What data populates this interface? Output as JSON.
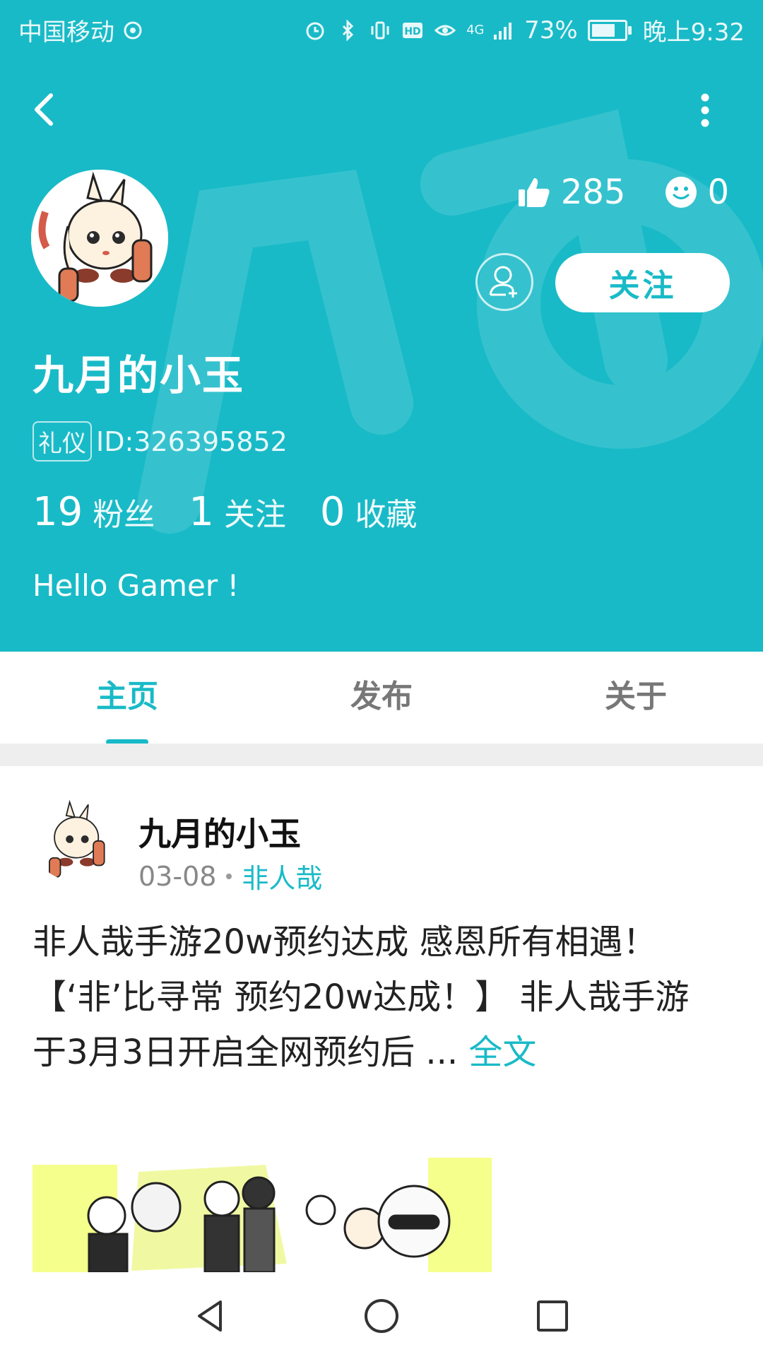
{
  "status_bar": {
    "carrier": "中国移动",
    "network": "4G",
    "battery": "73%",
    "battery_level": 0.73,
    "time": "晚上9:32"
  },
  "profile": {
    "username": "九月的小玉",
    "tag": "礼仪",
    "id_text": "ID:326395852",
    "likes": "285",
    "emoji_count": "0",
    "follow_label": "关注",
    "counts": [
      {
        "num": "19",
        "label": "粉丝"
      },
      {
        "num": "1",
        "label": "关注"
      },
      {
        "num": "0",
        "label": "收藏"
      }
    ],
    "bio": "Hello Gamer !"
  },
  "tabs": [
    {
      "label": "主页",
      "active": true
    },
    {
      "label": "发布",
      "active": false
    },
    {
      "label": "关于",
      "active": false
    }
  ],
  "post": {
    "author": "九月的小玉",
    "date": "03-08",
    "topic": "非人哉",
    "text_line1": "非人哉手游20w预约达成 感恩所有相遇！",
    "text_line2": "【‘非’比寻常  预约20w达成！】 非人哉手游于3月3日开启全网预约后 ...",
    "read_more": "全文"
  },
  "colors": {
    "accent": "#19bac7",
    "header_bg": "#19bac7"
  },
  "icons": {
    "back": "back-icon",
    "more": "more-icon",
    "like": "thumbs-up-icon",
    "smile": "smile-icon",
    "add_friend": "add-user-icon",
    "nav_back": "nav-back-icon",
    "nav_home": "nav-home-icon",
    "nav_recent": "nav-recent-icon"
  }
}
